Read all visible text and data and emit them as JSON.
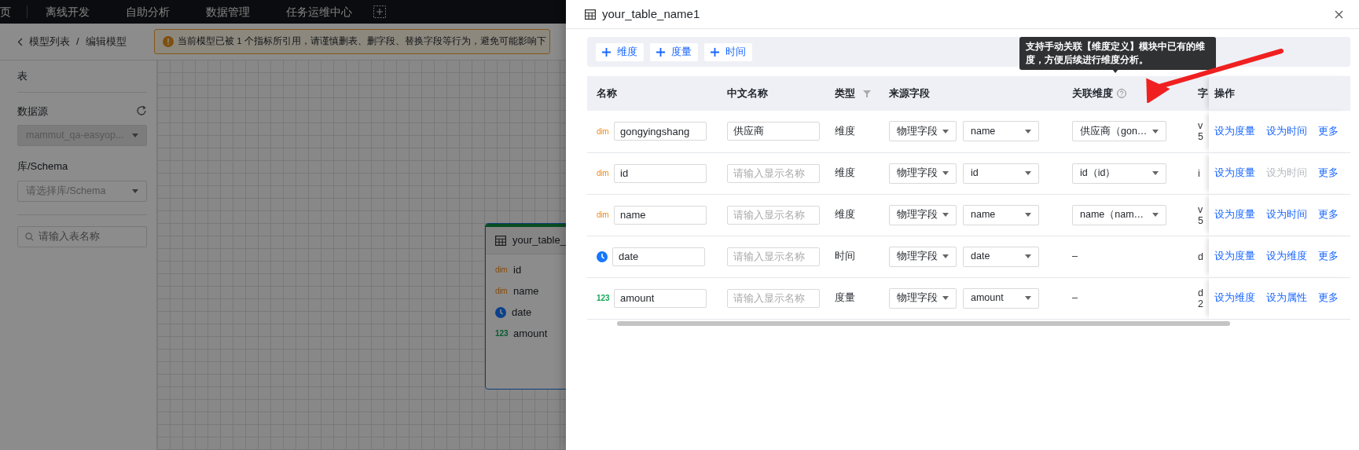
{
  "top_nav": {
    "items": [
      {
        "label": "页",
        "selected": false
      },
      {
        "label": "离线开发",
        "selected": false
      },
      {
        "label": "自助分析",
        "selected": false
      },
      {
        "label": "数据管理",
        "selected": false
      },
      {
        "label": "任务运维中心",
        "selected": false
      }
    ]
  },
  "breadcrumb": {
    "items": [
      "模型列表",
      "编辑模型"
    ],
    "separator": "/"
  },
  "alert": {
    "text": "当前模型已被 1 个指标所引用，请谨慎删表、删字段、替换字段等行为，避免可能影响下"
  },
  "sidebar": {
    "section_title": "表",
    "datasource": {
      "label": "数据源",
      "value": "mammut_qa-easyop...",
      "disabled": true
    },
    "schema": {
      "label": "库/Schema",
      "placeholder": "请选择库/Schema"
    },
    "search": {
      "placeholder": "请输入表名称"
    }
  },
  "canvas": {
    "nodes": [
      {
        "title": "your_table_",
        "fields": [
          {
            "kind": "dim",
            "icon_text": "dim",
            "name": "id"
          },
          {
            "kind": "dim",
            "icon_text": "dim",
            "name": "name"
          },
          {
            "kind": "time",
            "name": "date"
          },
          {
            "kind": "measure",
            "icon_text": "123",
            "name": "amount"
          }
        ]
      }
    ]
  },
  "drawer": {
    "title": "your_table_name1",
    "add_buttons": [
      {
        "label": "维度"
      },
      {
        "label": "度量"
      },
      {
        "label": "时间"
      }
    ],
    "tooltip": {
      "text": "支持手动关联【维度定义】模块中已有的维度，方便后续进行维度分析。"
    },
    "table": {
      "columns": [
        {
          "label": "名称"
        },
        {
          "label": "中文名称"
        },
        {
          "label": "类型",
          "filter": true
        },
        {
          "label": "来源字段"
        },
        {
          "label": "关联维度",
          "help": true
        },
        {
          "label": "字"
        },
        {
          "label": "操作"
        }
      ],
      "rows": [
        {
          "kind": "dim",
          "icon_text": "dim",
          "name": "gongyingshang",
          "cn_name": "供应商",
          "type": "维度",
          "source_type": "物理字段",
          "source_field": "name",
          "linked_dimension": "供应商（gon…",
          "column_6": [
            "v",
            "5"
          ],
          "actions": [
            {
              "label": "设为度量",
              "disabled": false
            },
            {
              "label": "设为时间",
              "disabled": false
            },
            {
              "label": "更多",
              "disabled": false
            }
          ]
        },
        {
          "kind": "dim",
          "icon_text": "dim",
          "name": "id",
          "cn_placeholder": "请输入显示名称",
          "type": "维度",
          "source_type": "物理字段",
          "source_field": "id",
          "linked_dimension": "id（id）",
          "column_6": [
            "i"
          ],
          "actions": [
            {
              "label": "设为度量",
              "disabled": false
            },
            {
              "label": "设为时间",
              "disabled": true
            },
            {
              "label": "更多",
              "disabled": false
            }
          ]
        },
        {
          "kind": "dim",
          "icon_text": "dim",
          "name": "name",
          "cn_placeholder": "请输入显示名称",
          "type": "维度",
          "source_type": "物理字段",
          "source_field": "name",
          "linked_dimension": "name（nam…",
          "column_6": [
            "v",
            "5"
          ],
          "actions": [
            {
              "label": "设为度量",
              "disabled": false
            },
            {
              "label": "设为时间",
              "disabled": false
            },
            {
              "label": "更多",
              "disabled": false
            }
          ]
        },
        {
          "kind": "time",
          "name": "date",
          "cn_placeholder": "请输入显示名称",
          "type": "时间",
          "source_type": "物理字段",
          "source_field": "date",
          "linked_dimension_text": "–",
          "column_6": [
            "d"
          ],
          "actions": [
            {
              "label": "设为度量",
              "disabled": false
            },
            {
              "label": "设为维度",
              "disabled": false
            },
            {
              "label": "更多",
              "disabled": false
            }
          ]
        },
        {
          "kind": "measure",
          "icon_text": "123",
          "name": "amount",
          "cn_placeholder": "请输入显示名称",
          "type": "度量",
          "source_type": "物理字段",
          "source_field": "amount",
          "linked_dimension_text": "–",
          "column_6": [
            "d",
            "2"
          ],
          "actions": [
            {
              "label": "设为维度",
              "disabled": false
            },
            {
              "label": "设为属性",
              "disabled": false
            },
            {
              "label": "更多",
              "disabled": false
            }
          ]
        }
      ]
    }
  }
}
